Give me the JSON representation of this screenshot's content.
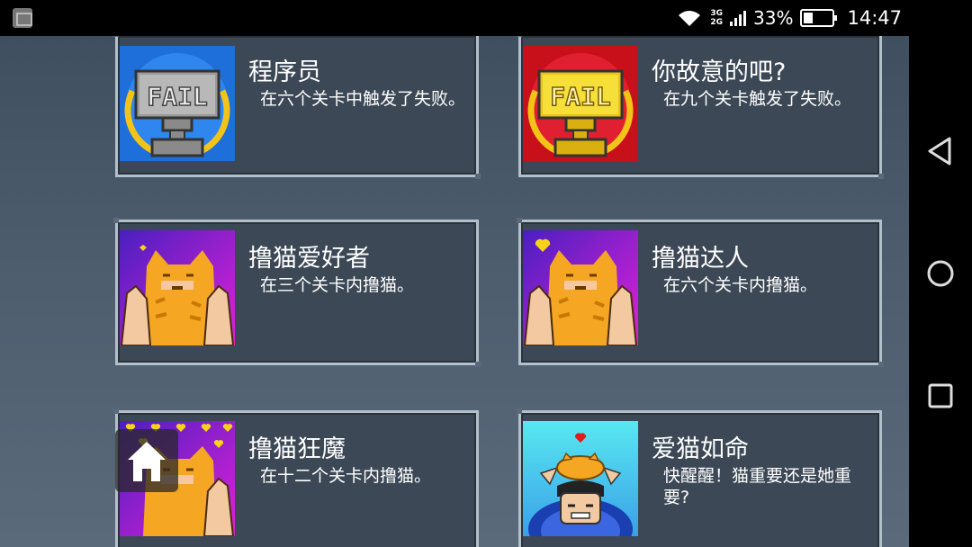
{
  "status_bar": {
    "network_top": "3G",
    "network_bottom": "2G",
    "battery_percent": "33%",
    "battery_level": 0.33,
    "time": "14:47",
    "icons": [
      "gallery-icon",
      "wifi-icon",
      "signal-icon",
      "battery-icon"
    ]
  },
  "achievements": [
    {
      "title": "程序员",
      "description": "在六个关卡中触发了失败。",
      "icon": "fail-trophy-silver-icon",
      "icon_text": "FAIL"
    },
    {
      "title": "你故意的吧?",
      "description": "在九个关卡触发了失败。",
      "icon": "fail-trophy-gold-icon",
      "icon_text": "FAIL"
    },
    {
      "title": "撸猫爱好者",
      "description": "在三个关卡内撸猫。",
      "icon": "pet-cat-icon"
    },
    {
      "title": "撸猫达人",
      "description": "在六个关卡内撸猫。",
      "icon": "pet-cat-heart-icon"
    },
    {
      "title": "撸猫狂魔",
      "description": "在十二个关卡内撸猫。",
      "icon": "pet-cat-hearts-icon"
    },
    {
      "title": "爱猫如命",
      "description": "快醒醒！猫重要还是她重要?",
      "icon": "cat-on-head-icon"
    }
  ],
  "navigation": {
    "buttons": [
      "back-icon",
      "home-icon",
      "recent-apps-icon"
    ]
  },
  "colors": {
    "background_top": "#3f4f5f",
    "card_bg": "#3c4856",
    "card_border": "#b3bfc9",
    "cat_orange": "#f5a623",
    "purple_bg": "#6a1fc9",
    "magenta_bg": "#d21fd6"
  }
}
